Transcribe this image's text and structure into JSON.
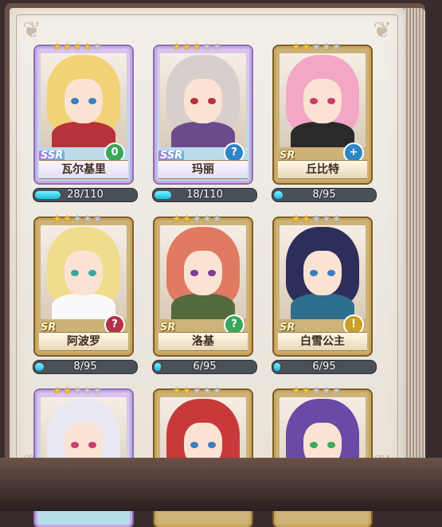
{
  "cards": [
    {
      "name": "瓦尔基里",
      "rarity": "SSR",
      "stars_on": 4,
      "stars_total": 5,
      "class_symbol": "0",
      "class_color": "#3aa85a",
      "progress_text": "28/110",
      "progress": 0.2545,
      "hair": "#f2d277",
      "body": "#b8323a",
      "eye": "#3b7dc4",
      "frame": "ssr"
    },
    {
      "name": "玛丽",
      "rarity": "SSR",
      "stars_on": 3,
      "stars_total": 5,
      "class_symbol": "?",
      "class_color": "#2d86c8",
      "progress_text": "18/110",
      "progress": 0.1636,
      "hair": "#d8cfcd",
      "body": "#6b4b8a",
      "eye": "#b8323a",
      "frame": "ssr"
    },
    {
      "name": "丘比特",
      "rarity": "SR",
      "stars_on": 2,
      "stars_total": 5,
      "class_symbol": "+",
      "class_color": "#2d86c8",
      "progress_text": "8/95",
      "progress": 0.0842,
      "hair": "#f3a7c7",
      "body": "#2a2a2a",
      "eye": "#c8406e",
      "frame": "sr"
    },
    {
      "name": "阿波罗",
      "rarity": "SR",
      "stars_on": 2,
      "stars_total": 5,
      "class_symbol": "?",
      "class_color": "#b3344a",
      "progress_text": "8/95",
      "progress": 0.0842,
      "hair": "#f0dc8e",
      "body": "#fafafa",
      "eye": "#3aa6a0",
      "frame": "sr"
    },
    {
      "name": "洛基",
      "rarity": "SR",
      "stars_on": 2,
      "stars_total": 5,
      "class_symbol": "?",
      "class_color": "#3aa85a",
      "progress_text": "6/95",
      "progress": 0.0632,
      "hair": "#e07a62",
      "body": "#536b3e",
      "eye": "#7a3c9a",
      "frame": "sr"
    },
    {
      "name": "白雪公主",
      "rarity": "SR",
      "stars_on": 2,
      "stars_total": 5,
      "class_symbol": "!",
      "class_color": "#c99f2a",
      "progress_text": "6/95",
      "progress": 0.0632,
      "hair": "#2e2e5a",
      "body": "#2f6f8e",
      "eye": "#3b7dc4",
      "frame": "sr"
    },
    {
      "name": "",
      "rarity": "",
      "stars_on": 2,
      "stars_total": 5,
      "class_symbol": "",
      "class_color": "#888",
      "progress_text": "",
      "progress": 0,
      "hair": "#eae8f2",
      "body": "#6b3e8a",
      "eye": "#c8406e",
      "frame": "ssr"
    },
    {
      "name": "",
      "rarity": "",
      "stars_on": 2,
      "stars_total": 5,
      "class_symbol": "",
      "class_color": "#888",
      "progress_text": "",
      "progress": 0,
      "hair": "#c83a3a",
      "body": "#c83a3a",
      "eye": "#3b7dc4",
      "frame": "sr"
    },
    {
      "name": "",
      "rarity": "",
      "stars_on": 2,
      "stars_total": 5,
      "class_symbol": "",
      "class_color": "#888",
      "progress_text": "",
      "progress": 0,
      "hair": "#6a4aa6",
      "body": "#2a2a2a",
      "eye": "#3aa85a",
      "frame": "sr"
    }
  ],
  "star_glyph": "★"
}
